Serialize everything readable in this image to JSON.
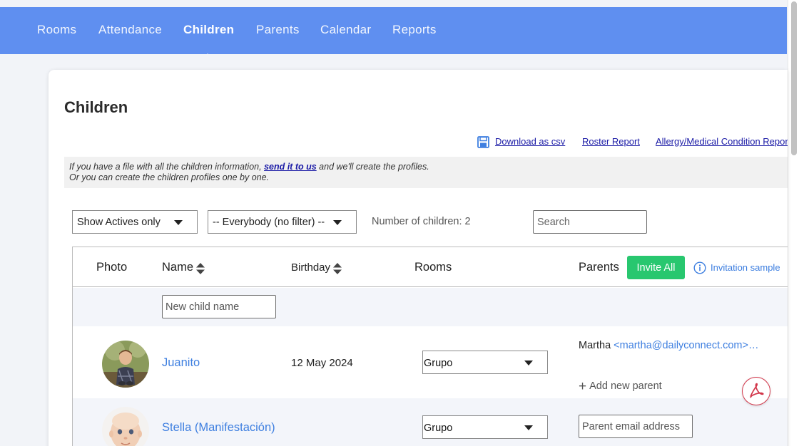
{
  "nav": {
    "items": [
      {
        "label": "Rooms"
      },
      {
        "label": "Attendance"
      },
      {
        "label": "Children"
      },
      {
        "label": "Parents"
      },
      {
        "label": "Calendar"
      },
      {
        "label": "Reports"
      }
    ],
    "active": "Children"
  },
  "page": {
    "title": "Children"
  },
  "links": {
    "download_csv": "Download as csv",
    "roster_report": "Roster Report",
    "allergy_report": "Allergy/Medical Condition Report"
  },
  "info": {
    "line1_prefix": "If you have a file with all the children information, ",
    "line1_link": "send it to us",
    "line1_suffix": " and we'll create the profiles.",
    "line2": "Or you can create the children profiles one by one."
  },
  "filters": {
    "status_selected": "Show Actives only",
    "group_selected": "-- Everybody (no filter) --",
    "count_label": "Number of children: 2",
    "search_placeholder": "Search"
  },
  "table": {
    "headers": {
      "photo": "Photo",
      "name": "Name",
      "birthday": "Birthday",
      "rooms": "Rooms",
      "parents": "Parents"
    },
    "invite_all_label": "Invite All",
    "invitation_sample_label": "Invitation sample",
    "new_child_placeholder": "New child name",
    "rows": [
      {
        "name": "Juanito",
        "birthday": "12 May 2024",
        "room": "Grupo",
        "parent_name": "Martha",
        "parent_email": "<martha@dailyconnect.com>…",
        "add_parent_label": "Add new parent"
      },
      {
        "name": "Stella (Manifestación)",
        "birthday": "",
        "room": "Grupo",
        "parent_email_placeholder": "Parent email address"
      }
    ]
  },
  "colors": {
    "nav_bg": "#5f8ff0",
    "link_blue": "#3e7fe0",
    "invite_green": "#28c76f",
    "pdf_red": "#d2364a"
  },
  "icons": [
    "save-icon",
    "sort-icon",
    "info-icon",
    "caret-down-icon",
    "plus-icon",
    "pdf-icon"
  ]
}
